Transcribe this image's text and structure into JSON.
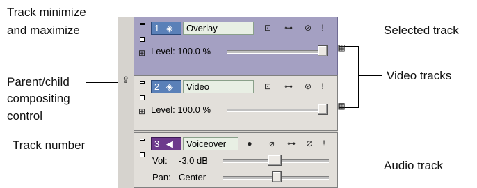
{
  "callouts": {
    "minimize_maximize_1": "Track minimize",
    "minimize_maximize_2": "and maximize",
    "parent_child_1": "Parent/child",
    "parent_child_2": "compositing",
    "parent_child_3": "control",
    "track_number": "Track number",
    "selected_track": "Selected track",
    "video_tracks": "Video tracks",
    "audio_track": "Audio track"
  },
  "tracks": {
    "overlay": {
      "number": "1",
      "name": "Overlay",
      "level_label": "Level:",
      "level_value": "100.0 %",
      "level_fraction": 1.0
    },
    "video": {
      "number": "2",
      "name": "Video",
      "level_label": "Level:",
      "level_value": "100.0 %",
      "level_fraction": 1.0
    },
    "audio": {
      "number": "3",
      "name": "Voiceover",
      "vol_label": "Vol:",
      "vol_value": "-3.0 dB",
      "pan_label": "Pan:",
      "pan_value": "Center"
    }
  },
  "colors": {
    "selected_track_bg": "#a4a0c2",
    "track_bg": "#e2dfda",
    "video_number_bg": "#5a80b8",
    "audio_number_bg": "#6d3a8c"
  },
  "icons": [
    "minimize-icon",
    "maximize-icon",
    "video-track-icon",
    "audio-track-icon",
    "bypass-motion-icon",
    "fx-icon",
    "mute-icon",
    "solo-icon",
    "compositing-mode-icon",
    "make-child-icon",
    "arm-record-icon",
    "invert-phase-icon"
  ]
}
